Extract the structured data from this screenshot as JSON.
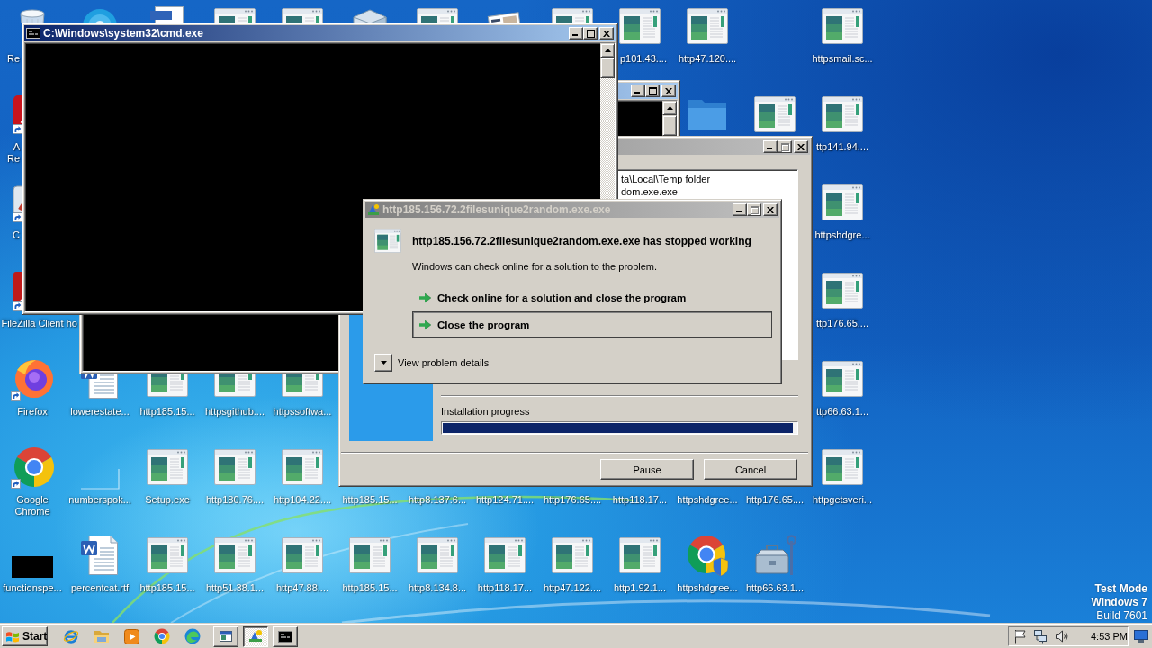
{
  "desktop": {
    "columns": [
      [
        {
          "kind": "recycle-bin",
          "label": "Re"
        },
        {
          "kind": "reader",
          "label": "A\nRe",
          "shortcut": true
        },
        {
          "kind": "cleaner",
          "label": "C",
          "shortcut": true
        },
        {
          "kind": "filezilla",
          "label": "FileZilla Client",
          "shortcut": true
        },
        {
          "kind": "firefox",
          "label": "Firefox",
          "shortcut": true
        },
        {
          "kind": "chrome",
          "label": "Google Chrome",
          "shortcut": true
        },
        {
          "kind": "dark-image",
          "label": "functionspe...",
          "shortcut": false
        }
      ],
      [
        {
          "kind": "chat-app"
        },
        null,
        null,
        {
          "label": "ho"
        },
        {
          "kind": "word",
          "label": "lowerestate...",
          "shortcut": false
        },
        {
          "kind": "blank",
          "label": "numberspok...",
          "shortcut": false
        },
        {
          "kind": "word",
          "label": "percentcat.rtf",
          "shortcut": false
        }
      ],
      [
        {
          "kind": "document"
        },
        null,
        null,
        null,
        {
          "kind": "program",
          "label": "http185.15...",
          "shortcut": false
        },
        {
          "kind": "program",
          "label": "Setup.exe",
          "shortcut": false
        },
        {
          "kind": "program",
          "label": "http185.15...",
          "shortcut": false
        }
      ],
      [
        {
          "kind": "program"
        },
        null,
        null,
        null,
        {
          "kind": "program",
          "label": "httpsgithub....",
          "shortcut": false
        },
        {
          "kind": "program",
          "label": "http180.76....",
          "shortcut": false
        },
        {
          "kind": "program",
          "label": "http51.38.1...",
          "shortcut": false
        }
      ],
      [
        {
          "kind": "program"
        },
        null,
        null,
        null,
        {
          "kind": "program",
          "label": "httpssoftwa...",
          "shortcut": false
        },
        {
          "kind": "program",
          "label": "http104.22....",
          "shortcut": false
        },
        {
          "kind": "program",
          "label": "http47.88....",
          "shortcut": false
        }
      ],
      [
        {
          "kind": "package"
        },
        null,
        null,
        null,
        null,
        {
          "label": "http185.15..."
        },
        {
          "kind": "program",
          "label": "http185.15...",
          "shortcut": false
        }
      ],
      [
        {
          "kind": "program"
        },
        null,
        null,
        null,
        null,
        {
          "label": "http8.137.6..."
        },
        {
          "kind": "program",
          "label": "http8.134.8...",
          "shortcut": false
        }
      ],
      [
        {
          "kind": "photo-card"
        },
        null,
        null,
        null,
        null,
        {
          "label": "http124.71...."
        },
        {
          "kind": "program",
          "label": "http118.17...",
          "shortcut": false
        }
      ],
      [
        {
          "kind": "program"
        },
        null,
        null,
        null,
        null,
        {
          "label": "http176.65...."
        },
        {
          "kind": "program",
          "label": "http47.122....",
          "shortcut": false
        }
      ],
      [
        {
          "kind": "program",
          "label": "p101.43....",
          "shortcut": false
        },
        null,
        null,
        null,
        null,
        {
          "label": "http118.17..."
        },
        {
          "kind": "program",
          "label": "http1.92.1...",
          "shortcut": false
        }
      ],
      [
        {
          "kind": "program",
          "label": "http47.120....",
          "shortcut": false
        },
        {
          "kind": "folder",
          "shortcut": false
        },
        null,
        null,
        null,
        {
          "label": "httpshdgree..."
        },
        {
          "kind": "browser-shield",
          "label": "httpshdgree...",
          "shortcut": false
        }
      ],
      [
        null,
        {
          "kind": "program",
          "shortcut": false
        },
        null,
        null,
        null,
        {
          "label": "http176.65...."
        },
        {
          "kind": "toolbox",
          "label": "http66.63.1...",
          "shortcut": false
        }
      ],
      [
        {
          "kind": "program",
          "label": "httpsmail.sc...",
          "shortcut": false
        },
        {
          "kind": "program",
          "label": "ttp141.94....",
          "shortcut": false
        },
        {
          "kind": "program",
          "label": "httpshdgre...",
          "shortcut": false
        },
        {
          "kind": "program",
          "label": "ttp176.65....",
          "shortcut": false
        },
        {
          "kind": "program",
          "label": "ttp66.63.1...",
          "shortcut": false
        },
        {
          "kind": "program",
          "label": "httpgetsveri...",
          "shortcut": false
        },
        null
      ]
    ],
    "notice": [
      {
        "text": "Test Mode",
        "bold": true
      },
      {
        "text": "Windows 7",
        "bold": true
      },
      {
        "text": "Build 7601",
        "bold": false
      }
    ]
  },
  "windows": [
    {
      "kind": "console",
      "active": true,
      "controls": [
        {
          "kind": "minimize",
          "disabled": false
        },
        {
          "kind": "maximize",
          "disabled": false
        },
        {
          "kind": "close",
          "disabled": false
        }
      ]
    },
    {
      "kind": "installer",
      "active": false,
      "controls": [
        {
          "kind": "minimize",
          "disabled": false
        },
        {
          "kind": "maximize",
          "disabled": true
        },
        {
          "kind": "close",
          "disabled": false
        }
      ],
      "log_lines": [
        "ta\\Local\\Temp folder",
        "dom.exe.exe"
      ],
      "progress_label": "Installation progress",
      "progress": {
        "level": 0.99
      },
      "buttons": [
        "Pause",
        "Cancel"
      ]
    },
    {
      "kind": "console",
      "active": true,
      "title": "C:\\Windows\\system32\\cmd.exe",
      "controls": [
        {
          "kind": "minimize",
          "disabled": false
        },
        {
          "kind": "maximize",
          "disabled": false
        },
        {
          "kind": "close",
          "disabled": false
        }
      ]
    },
    {
      "kind": "error-report",
      "active": false,
      "title": "http185.156.72.2filesunique2random.exe.exe",
      "controls": [
        {
          "kind": "minimize",
          "disabled": false
        },
        {
          "kind": "maximize",
          "disabled": true
        },
        {
          "kind": "close",
          "disabled": false
        }
      ],
      "heading": "http185.156.72.2filesunique2random.exe.exe has stopped working",
      "message": "Windows can check online for a solution to the problem.",
      "options": [
        {
          "label": "Check online for a solution and close the program",
          "selected": false
        },
        {
          "label": "Close the program",
          "selected": true
        }
      ],
      "details": {
        "label": "View problem details",
        "expanded": false
      }
    }
  ],
  "taskbar": {
    "start": "Start",
    "quick_launch": [
      {
        "kind": "ie"
      },
      {
        "kind": "explorer"
      },
      {
        "kind": "media-player"
      },
      {
        "kind": "chrome"
      },
      {
        "kind": "edge"
      }
    ],
    "tasks": [
      {
        "kind": "installer",
        "selected": false
      },
      {
        "kind": "error-report",
        "selected": true
      },
      {
        "kind": "console",
        "selected": false
      }
    ],
    "tray": [
      {
        "kind": "flag"
      },
      {
        "kind": "network"
      },
      {
        "kind": "volume"
      }
    ],
    "clock": "4:53 PM"
  }
}
